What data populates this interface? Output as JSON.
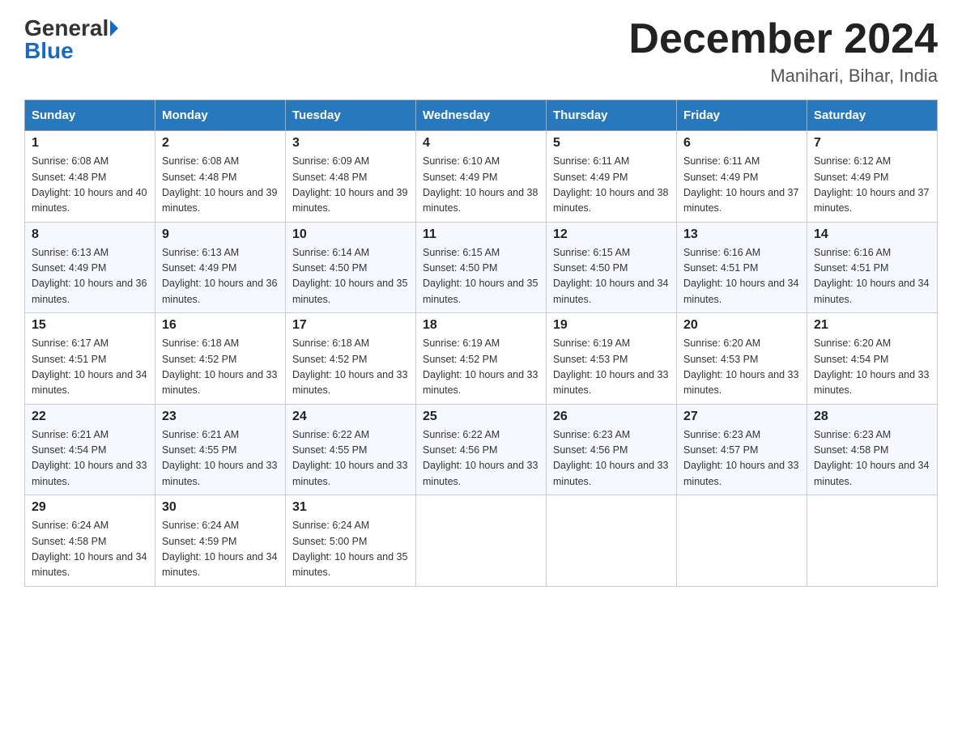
{
  "header": {
    "logo_line1": "General",
    "logo_line2": "Blue",
    "month": "December 2024",
    "location": "Manihari, Bihar, India"
  },
  "weekdays": [
    "Sunday",
    "Monday",
    "Tuesday",
    "Wednesday",
    "Thursday",
    "Friday",
    "Saturday"
  ],
  "weeks": [
    [
      {
        "day": "1",
        "sunrise": "6:08 AM",
        "sunset": "4:48 PM",
        "daylight": "10 hours and 40 minutes."
      },
      {
        "day": "2",
        "sunrise": "6:08 AM",
        "sunset": "4:48 PM",
        "daylight": "10 hours and 39 minutes."
      },
      {
        "day": "3",
        "sunrise": "6:09 AM",
        "sunset": "4:48 PM",
        "daylight": "10 hours and 39 minutes."
      },
      {
        "day": "4",
        "sunrise": "6:10 AM",
        "sunset": "4:49 PM",
        "daylight": "10 hours and 38 minutes."
      },
      {
        "day": "5",
        "sunrise": "6:11 AM",
        "sunset": "4:49 PM",
        "daylight": "10 hours and 38 minutes."
      },
      {
        "day": "6",
        "sunrise": "6:11 AM",
        "sunset": "4:49 PM",
        "daylight": "10 hours and 37 minutes."
      },
      {
        "day": "7",
        "sunrise": "6:12 AM",
        "sunset": "4:49 PM",
        "daylight": "10 hours and 37 minutes."
      }
    ],
    [
      {
        "day": "8",
        "sunrise": "6:13 AM",
        "sunset": "4:49 PM",
        "daylight": "10 hours and 36 minutes."
      },
      {
        "day": "9",
        "sunrise": "6:13 AM",
        "sunset": "4:49 PM",
        "daylight": "10 hours and 36 minutes."
      },
      {
        "day": "10",
        "sunrise": "6:14 AM",
        "sunset": "4:50 PM",
        "daylight": "10 hours and 35 minutes."
      },
      {
        "day": "11",
        "sunrise": "6:15 AM",
        "sunset": "4:50 PM",
        "daylight": "10 hours and 35 minutes."
      },
      {
        "day": "12",
        "sunrise": "6:15 AM",
        "sunset": "4:50 PM",
        "daylight": "10 hours and 34 minutes."
      },
      {
        "day": "13",
        "sunrise": "6:16 AM",
        "sunset": "4:51 PM",
        "daylight": "10 hours and 34 minutes."
      },
      {
        "day": "14",
        "sunrise": "6:16 AM",
        "sunset": "4:51 PM",
        "daylight": "10 hours and 34 minutes."
      }
    ],
    [
      {
        "day": "15",
        "sunrise": "6:17 AM",
        "sunset": "4:51 PM",
        "daylight": "10 hours and 34 minutes."
      },
      {
        "day": "16",
        "sunrise": "6:18 AM",
        "sunset": "4:52 PM",
        "daylight": "10 hours and 33 minutes."
      },
      {
        "day": "17",
        "sunrise": "6:18 AM",
        "sunset": "4:52 PM",
        "daylight": "10 hours and 33 minutes."
      },
      {
        "day": "18",
        "sunrise": "6:19 AM",
        "sunset": "4:52 PM",
        "daylight": "10 hours and 33 minutes."
      },
      {
        "day": "19",
        "sunrise": "6:19 AM",
        "sunset": "4:53 PM",
        "daylight": "10 hours and 33 minutes."
      },
      {
        "day": "20",
        "sunrise": "6:20 AM",
        "sunset": "4:53 PM",
        "daylight": "10 hours and 33 minutes."
      },
      {
        "day": "21",
        "sunrise": "6:20 AM",
        "sunset": "4:54 PM",
        "daylight": "10 hours and 33 minutes."
      }
    ],
    [
      {
        "day": "22",
        "sunrise": "6:21 AM",
        "sunset": "4:54 PM",
        "daylight": "10 hours and 33 minutes."
      },
      {
        "day": "23",
        "sunrise": "6:21 AM",
        "sunset": "4:55 PM",
        "daylight": "10 hours and 33 minutes."
      },
      {
        "day": "24",
        "sunrise": "6:22 AM",
        "sunset": "4:55 PM",
        "daylight": "10 hours and 33 minutes."
      },
      {
        "day": "25",
        "sunrise": "6:22 AM",
        "sunset": "4:56 PM",
        "daylight": "10 hours and 33 minutes."
      },
      {
        "day": "26",
        "sunrise": "6:23 AM",
        "sunset": "4:56 PM",
        "daylight": "10 hours and 33 minutes."
      },
      {
        "day": "27",
        "sunrise": "6:23 AM",
        "sunset": "4:57 PM",
        "daylight": "10 hours and 33 minutes."
      },
      {
        "day": "28",
        "sunrise": "6:23 AM",
        "sunset": "4:58 PM",
        "daylight": "10 hours and 34 minutes."
      }
    ],
    [
      {
        "day": "29",
        "sunrise": "6:24 AM",
        "sunset": "4:58 PM",
        "daylight": "10 hours and 34 minutes."
      },
      {
        "day": "30",
        "sunrise": "6:24 AM",
        "sunset": "4:59 PM",
        "daylight": "10 hours and 34 minutes."
      },
      {
        "day": "31",
        "sunrise": "6:24 AM",
        "sunset": "5:00 PM",
        "daylight": "10 hours and 35 minutes."
      },
      null,
      null,
      null,
      null
    ]
  ]
}
